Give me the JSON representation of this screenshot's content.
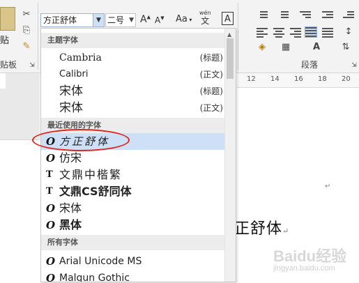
{
  "ribbon": {
    "paste_label": "贴",
    "clipboard_group": "贴板",
    "font_name_value": "方正舒体",
    "font_size_value": "二号",
    "grow_font": "A",
    "shrink_font": "A",
    "change_case": "Aa",
    "phonetic_top": "wén",
    "phonetic_bottom": "文",
    "char_border": "A",
    "paragraph_group": "段落"
  },
  "ruler": {
    "ticks": [
      "12",
      "14",
      "16",
      "18",
      "20"
    ]
  },
  "font_dropdown": {
    "theme_header": "主题字体",
    "theme_fonts": [
      {
        "name": "Cambria",
        "tag": "(标题)"
      },
      {
        "name": "Calibri",
        "tag": "(正文)"
      },
      {
        "name": "宋体",
        "tag": "(标题)"
      },
      {
        "name": "宋体",
        "tag": "(正文)"
      }
    ],
    "recent_header": "最近使用的字体",
    "recent_fonts": [
      {
        "name": "方正舒体",
        "icon": "opentype-icon",
        "glyph": "O"
      },
      {
        "name": "仿宋",
        "icon": "opentype-icon",
        "glyph": "O"
      },
      {
        "name": "文鼎中楷繁",
        "icon": "truetype-icon",
        "glyph": "T"
      },
      {
        "name": "文鼎CS舒同体",
        "icon": "truetype-icon",
        "glyph": "T"
      },
      {
        "name": "宋体",
        "icon": "opentype-icon",
        "glyph": "O"
      },
      {
        "name": "黑体",
        "icon": "opentype-icon",
        "glyph": "O"
      }
    ],
    "all_header": "所有字体",
    "all_fonts": [
      {
        "name": "Arial Unicode MS",
        "icon": "opentype-icon",
        "glyph": "O"
      },
      {
        "name": "Malgun Gothic",
        "icon": "opentype-icon",
        "glyph": "O"
      }
    ]
  },
  "document": {
    "text": "正舒体",
    "watermark_main": "Baidu经验",
    "watermark_sub": "jingyan.baidu.com"
  },
  "colors": {
    "selection": "#cde0f7",
    "highlight_circle": "#e0241b"
  }
}
